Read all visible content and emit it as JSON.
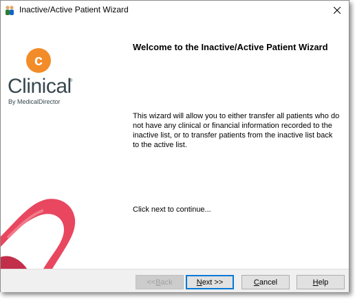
{
  "window": {
    "title": "Inactive/Active Patient Wizard",
    "icons": {
      "app": "users-icon",
      "close": "close-icon"
    }
  },
  "logo": {
    "letter": "c",
    "word": "Clinical",
    "tm": "®",
    "sub": "By MedicalDirector",
    "colors": {
      "orange": "#f28c28",
      "text": "#37474f",
      "heart": "#e8475f"
    }
  },
  "content": {
    "heading": "Welcome to the Inactive/Active Patient Wizard",
    "description": "This wizard will allow you to either transfer all patients who do not have any clinical or financial information recorded to the inactive list, or to transfer patients from the inactive list back to the active list.",
    "continue_text": "Click next to continue..."
  },
  "buttons": {
    "back": {
      "pre": "<< ",
      "u": "B",
      "post": "ack"
    },
    "next": {
      "pre": "",
      "u": "N",
      "post": "ext >>"
    },
    "cancel": {
      "pre": "",
      "u": "C",
      "post": "ancel"
    },
    "help": {
      "pre": "",
      "u": "H",
      "post": "elp"
    }
  }
}
